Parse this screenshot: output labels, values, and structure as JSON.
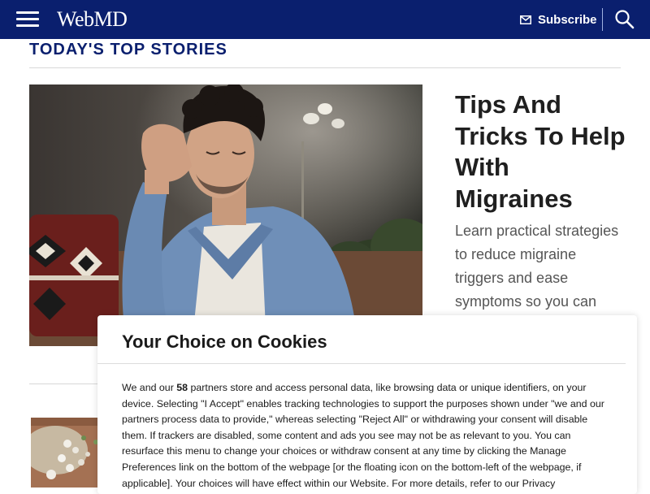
{
  "header": {
    "logo_text": "WebMD",
    "subscribe_label": "Subscribe",
    "background_color": "#0a1f6e",
    "icons": [
      "hamburger-menu-icon",
      "mail-icon",
      "search-icon"
    ]
  },
  "section": {
    "title": "TODAY'S TOP STORIES"
  },
  "hero": {
    "title": "Tips And Tricks To Help With Migraines",
    "description": "Learn practical strategies to reduce migraine triggers and ease symptoms so you can"
  },
  "cookie_dialog": {
    "title": "Your Choice on Cookies",
    "body_before_count": "We and our ",
    "partner_count": "58",
    "body_after_count": " partners store and access personal data, like browsing data or unique identifiers, on your device. Selecting \"I Accept\" enables tracking technologies to support the purposes shown under \"we and our partners process data to provide,\" whereas selecting \"Reject All\" or withdrawing your consent will disable them. If trackers are disabled, some content and ads you see may not be as relevant to you. You can resurface this menu to change your choices or withdraw consent at any time by clicking the Manage Preferences link on the bottom of the webpage [or the floating icon on the bottom-left of the webpage, if applicable]. Your choices will have effect within our Website. For more details, refer to our Privacy"
  }
}
